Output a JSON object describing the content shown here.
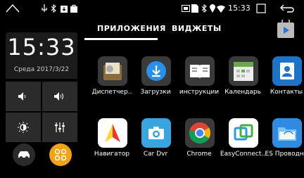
{
  "statusbar": {
    "time": "15:33",
    "left_icons": [
      "home-outline-icon",
      "usb-icon",
      "bluetooth-icon",
      "download-box-icon",
      "shopping-bag-icon"
    ],
    "right_icons": [
      "cast-icon",
      "sim-icon",
      "bluetooth-icon",
      "location-icon",
      "wifi-icon"
    ]
  },
  "clock": {
    "time": "15:33",
    "date": "Среда 2017/3/22"
  },
  "tabs": [
    {
      "label": "ПРИЛОЖЕНИЯ",
      "active": true
    },
    {
      "label": "ВИДЖЕТЫ",
      "active": false
    }
  ],
  "apps": [
    {
      "label": "Диспетчер..",
      "icon": "task-manager-icon"
    },
    {
      "label": "Загрузки",
      "icon": "download-icon"
    },
    {
      "label": "инструкции",
      "icon": "book-icon"
    },
    {
      "label": "Календарь",
      "icon": "calendar-icon"
    },
    {
      "label": "Контакты",
      "icon": "contacts-icon"
    },
    {
      "label": "Навигатор",
      "icon": "navigator-icon"
    },
    {
      "label": "Car Dvr",
      "icon": "camera-icon"
    },
    {
      "label": "Chrome",
      "icon": "chrome-icon"
    },
    {
      "label": "EasyConnect..",
      "icon": "easyconnect-icon"
    },
    {
      "label": "ES Проводн..",
      "icon": "es-explorer-icon"
    }
  ],
  "colors": {
    "accent": "#f3a21a",
    "tab_active": "#ffffff"
  }
}
